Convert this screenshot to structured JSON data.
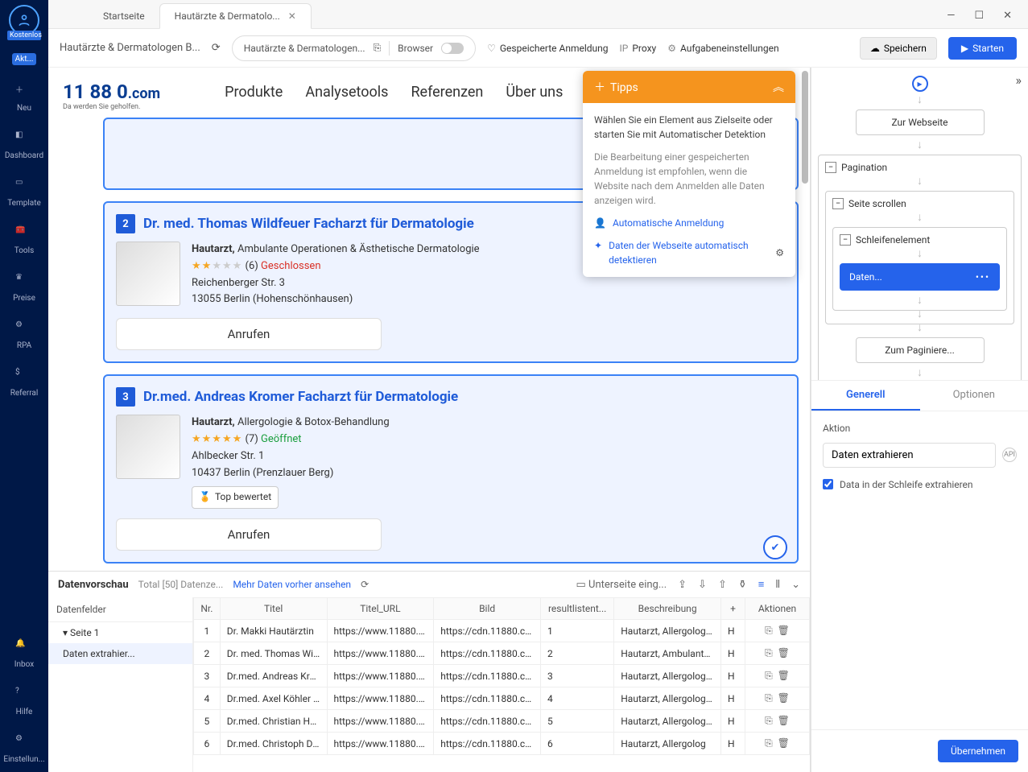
{
  "rail": {
    "free": "Kostenlos",
    "act": "Akt...",
    "new": "Neu",
    "dashboard": "Dashboard",
    "template": "Template",
    "tools": "Tools",
    "price": "Preise",
    "rpa": "RPA",
    "referral": "Referral",
    "inbox": "Inbox",
    "help": "Hilfe",
    "settings": "Einstellun..."
  },
  "tabs": {
    "home": "Startseite",
    "active": "Hautärzte & Dermatolo..."
  },
  "toolbar": {
    "url": "Hautärzte & Dermatologen B...",
    "pill_text": "Hautärzte & Dermatologen...",
    "pill_mode": "Browser",
    "saved": "Gespeicherte Anmeldung",
    "proxy": "Proxy",
    "settings": "Aufgabeneinstellungen",
    "save": "Speichern",
    "start": "Starten"
  },
  "site": {
    "logo": "11 88 0",
    "dotcom": ".com",
    "sub": "Da werden Sie geholfen.",
    "nav": [
      "Produkte",
      "Analysetools",
      "Referenzen",
      "Über uns"
    ]
  },
  "results": [
    {
      "num": "2",
      "title": "Dr. med. Thomas Wildfeuer Facharzt für Dermatologie",
      "cat_bold": "Hautarzt,",
      "cat_rest": " Ambulante Operationen & Ästhetische Dermatologie",
      "stars_full": "★★",
      "stars_empty": "★★★",
      "count": "(6)",
      "status": "Geschlossen",
      "status_class": "closed",
      "addr1": "Reichenberger Str. 3",
      "addr2": "13055 Berlin (Hohenschönhausen)",
      "top": false,
      "call": "Anrufen"
    },
    {
      "num": "3",
      "title": "Dr.med. Andreas Kromer Facharzt für Dermatologie",
      "cat_bold": "Hautarzt,",
      "cat_rest": " Allergologie & Botox-Behandlung",
      "stars_full": "★★★★★",
      "stars_empty": "",
      "count": "(7)",
      "status": "Geöffnet",
      "status_class": "open",
      "addr1": "Ahlbecker Str. 1",
      "addr2": "10437 Berlin (Prenzlauer Berg)",
      "top": true,
      "top_label": "Top bewertet",
      "call": "Anrufen"
    }
  ],
  "tipps": {
    "title": "Tipps",
    "p1": "Wählen Sie ein Element aus Zielseite oder starten Sie mit Automatischer Detektion",
    "p2": "Die Bearbeitung einer gespeicherten Anmeldung ist empfohlen, wenn die Website nach dem Anmelden alle Daten anzeigen wird.",
    "link1": "Automatische Anmeldung",
    "link2": "Daten der Webseite automatisch detektieren"
  },
  "preview": {
    "title": "Datenvorschau",
    "total": "Total [50] Datenze...",
    "more": "Mehr Daten vorher ansehen",
    "subpage": "Unterseite eing...",
    "tree_head": "Datenfelder",
    "tree_page": "Seite 1",
    "tree_item": "Daten extrahier...",
    "cols": [
      "Nr.",
      "Titel",
      "Titel_URL",
      "Bild",
      "resultlistent...",
      "Beschreibung",
      "",
      "Aktionen"
    ],
    "rows": [
      {
        "n": "1",
        "t": "Dr. Makki Hautärztin",
        "u": "https://www.11880.c...",
        "b": "https://cdn.11880.co...",
        "r": "1",
        "d": "Hautarzt, Allergologi...",
        "h": "H"
      },
      {
        "n": "2",
        "t": "Dr. med. Thomas Wil...",
        "u": "https://www.11880.c...",
        "b": "https://cdn.11880.co...",
        "r": "2",
        "d": "Hautarzt, Ambulante...",
        "h": "H"
      },
      {
        "n": "3",
        "t": "Dr.med. Andreas Kro...",
        "u": "https://www.11880.c...",
        "b": "https://cdn.11880.co...",
        "r": "3",
        "d": "Hautarzt, Allergologi...",
        "h": "H"
      },
      {
        "n": "4",
        "t": "Dr.med. Axel Köhler ...",
        "u": "https://www.11880.c...",
        "b": "https://cdn.11880.co...",
        "r": "4",
        "d": "Hautarzt, Allergologi...",
        "h": "H"
      },
      {
        "n": "5",
        "t": "Dr.med. Christian Ho...",
        "u": "https://www.11880.c...",
        "b": "https://cdn.11880.co...",
        "r": "5",
        "d": "Hautarzt, Allergologi...",
        "h": "H"
      },
      {
        "n": "6",
        "t": "Dr.med. Christoph Di...",
        "u": "https://www.11880.c...",
        "b": "https://cdn.11880.co...",
        "r": "6",
        "d": "Hautarzt, Allergolog",
        "h": "H"
      }
    ]
  },
  "wf": {
    "to_site": "Zur Webseite",
    "pagination": "Pagination",
    "scroll": "Seite scrollen",
    "loop": "Schleifenelement",
    "data": "Daten...",
    "paginate": "Zum Paginiere..."
  },
  "rp": {
    "tab1": "Generell",
    "tab2": "Optionen",
    "action_label": "Aktion",
    "action_value": "Daten extrahieren",
    "cb": "Data in der Schleife extrahieren",
    "apply": "Übernehmen"
  }
}
